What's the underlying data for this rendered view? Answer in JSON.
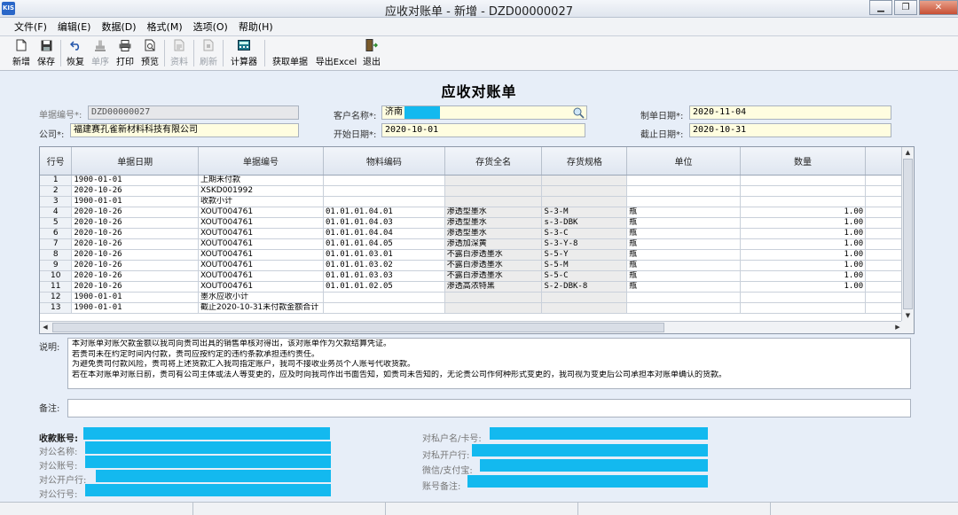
{
  "window": {
    "logo": "KIS",
    "title": "应收对账单 - 新增 - DZD00000027",
    "minimize_glyph": "▁",
    "restore_glyph": "❐",
    "close_glyph": "✕"
  },
  "menu": [
    "文件(F)",
    "编辑(E)",
    "数据(D)",
    "格式(M)",
    "选项(O)",
    "帮助(H)"
  ],
  "toolbar": {
    "new": "新增",
    "save": "保存",
    "restore": "恢复",
    "unit_order": "单序",
    "print": "打印",
    "preview": "预览",
    "data": "资料",
    "refresh": "刷新",
    "calculator": "计算器",
    "fetch": "获取单据",
    "export": "导出Excel",
    "exit": "退出"
  },
  "form": {
    "title": "应收对账单",
    "doc_no_label": "单据编号*:",
    "doc_no": "DZD00000027",
    "customer_label": "客户名称*:",
    "customer": "济南",
    "created_label": "制单日期*:",
    "created": "2020-11-04",
    "company_label": "公司*:",
    "company": "福建赛孔雀新材料科技有限公司",
    "start_label": "开始日期*:",
    "start": "2020-10-01",
    "end_label": "截止日期*:",
    "end": "2020-10-31"
  },
  "grid": {
    "headers": [
      "行号",
      "单据日期",
      "单据编号",
      "物料编码",
      "存货全名",
      "存货规格",
      "单位",
      "数量"
    ],
    "rows": [
      [
        "1",
        "1900-01-01",
        "上期未付款",
        "",
        "",
        "",
        "",
        ""
      ],
      [
        "2",
        "2020-10-26",
        "XSKD001992",
        "",
        "",
        "",
        "",
        ""
      ],
      [
        "3",
        "1900-01-01",
        "收款小计",
        "",
        "",
        "",
        "",
        ""
      ],
      [
        "4",
        "2020-10-26",
        "XOUT004761",
        "01.01.01.04.01",
        "渗透型墨水",
        "S-3-M",
        "瓶",
        "1.00"
      ],
      [
        "5",
        "2020-10-26",
        "XOUT004761",
        "01.01.01.04.03",
        "渗透型墨水",
        "s-3-DBK",
        "瓶",
        "1.00"
      ],
      [
        "6",
        "2020-10-26",
        "XOUT004761",
        "01.01.01.04.04",
        "渗透型墨水",
        "S-3-C",
        "瓶",
        "1.00"
      ],
      [
        "7",
        "2020-10-26",
        "XOUT004761",
        "01.01.01.04.05",
        "渗透加深黄",
        "S-3-Y-8",
        "瓶",
        "1.00"
      ],
      [
        "8",
        "2020-10-26",
        "XOUT004761",
        "01.01.01.03.01",
        "不露白渗透墨水",
        "S-5-Y",
        "瓶",
        "1.00"
      ],
      [
        "9",
        "2020-10-26",
        "XOUT004761",
        "01.01.01.03.02",
        "不露白渗透墨水",
        "S-5-M",
        "瓶",
        "1.00"
      ],
      [
        "10",
        "2020-10-26",
        "XOUT004761",
        "01.01.01.03.03",
        "不露白渗透墨水",
        "S-5-C",
        "瓶",
        "1.00"
      ],
      [
        "11",
        "2020-10-26",
        "XOUT004761",
        "01.01.01.02.05",
        "渗透高浓特黑",
        "S-2-DBK-8",
        "瓶",
        "1.00"
      ],
      [
        "12",
        "1900-01-01",
        "墨水应收小计",
        "",
        "",
        "",
        "",
        ""
      ],
      [
        "13",
        "1900-01-01",
        "截止2020-10-31未付款金额合计",
        "",
        "",
        "",
        "",
        ""
      ]
    ]
  },
  "notes": {
    "label": "说明:",
    "lines": [
      "本对账单对账欠款金额以我司向贵司出具的销售单核对得出，该对账单作为欠款结算凭证。",
      "若贵司未在约定时间内付款，贵司应按约定的违约条款承担违约责任。",
      "为避免贵司付款风险，贵司将上述货款汇入我司指定账户，我司不接收业务员个人账号代收货款。",
      "若在本对账单对账日前，贵司有公司主体或法人等变更的，应及时向我司作出书面告知，如贵司未告知的，无论贵公司作何种形式变更的，我司视为变更后公司承担本对账单确认的货款。"
    ]
  },
  "remark": {
    "label": "备注:"
  },
  "bank": {
    "receive_account": "收款账号:",
    "public_name": "对公名称:",
    "public_account": "对公账号:",
    "public_bank": "对公开户行:",
    "public_bank_no": "对公行号:",
    "private_name": "对私户名/卡号:",
    "private_bank": "对私开户行:",
    "wechat": "微信/支付宝:",
    "account_remark": "账号备注:"
  },
  "colors": {
    "mask": "#13b9ef",
    "field": "#fffde0",
    "background": "#e7eef8"
  }
}
